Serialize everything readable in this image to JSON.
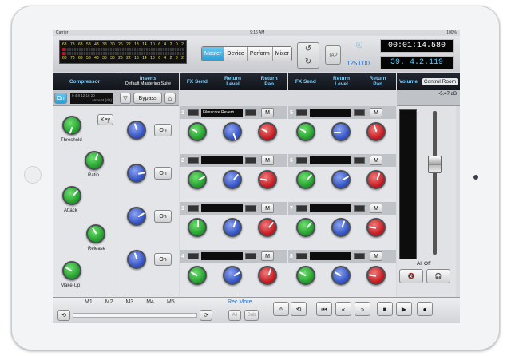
{
  "status": {
    "carrier": "Carrier",
    "time": "9:16 AM",
    "battery": "100%"
  },
  "meter": {
    "labels": [
      "68",
      "78",
      "68",
      "58",
      "48",
      "38",
      "30",
      "26",
      "22",
      "18",
      "14",
      "10",
      "6",
      "4",
      "2",
      "0",
      "2"
    ]
  },
  "modes": [
    "Master",
    "Device",
    "Perform",
    "Mixer"
  ],
  "tap_label": "TAP",
  "info_icon": "ⓘ",
  "bpm": "125.000",
  "time_display": "00:01:14.580",
  "bars_display": "39. 4.2.119",
  "headers": {
    "compressor": "Compressor",
    "inserts": "Inserts",
    "inserts_sub": "Default Mastering Suite",
    "fx_send": "FX Send",
    "return_level": "Return Level",
    "return_pan": "Return Pan",
    "volume": "Volume",
    "control_room": "Control Room",
    "volume_value": "-5.47 dB"
  },
  "comp": {
    "on": "On",
    "amount_scale": "0  4  8 12 16 20",
    "amount_label": "amount (dB)",
    "key": "Key",
    "threshold": "Threshold",
    "ratio": "Ratio",
    "attack": "Attack",
    "release": "Release",
    "makeup": "Make-Up"
  },
  "inserts": {
    "bypass": "Bypass",
    "on_labels": [
      "On",
      "On",
      "On",
      "On"
    ]
  },
  "sends": [
    {
      "num": "1",
      "name": "Filmscore Reverb",
      "m": "M"
    },
    {
      "num": "2",
      "name": "",
      "m": "M"
    },
    {
      "num": "3",
      "name": "",
      "m": "M"
    },
    {
      "num": "4",
      "name": "",
      "m": "M"
    },
    {
      "num": "5",
      "name": "",
      "m": "M"
    },
    {
      "num": "6",
      "name": "",
      "m": "M"
    },
    {
      "num": "7",
      "name": "",
      "m": "M"
    },
    {
      "num": "8",
      "name": "",
      "m": "M"
    }
  ],
  "all_off": "All Off",
  "transport": {
    "markers": [
      "M1",
      "M2",
      "M3",
      "M4",
      "M5"
    ],
    "rec_more": "Rec More",
    "all": "All",
    "dub": "Dub"
  },
  "colors": {
    "accent": "#2c9ed8",
    "header_text": "#7ed1ff",
    "knob_green": "#1f9a2a",
    "knob_blue": "#2f4fc3",
    "knob_red": "#c2151b"
  }
}
